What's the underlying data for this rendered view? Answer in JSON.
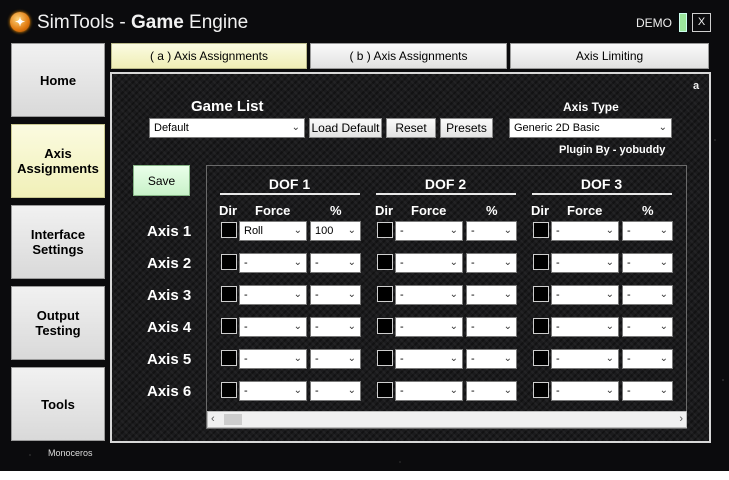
{
  "window": {
    "title_part1": "SimTools",
    "title_sep": " - ",
    "title_part2": "Game",
    "title_part3": " Engine",
    "demo_label": "DEMO",
    "close_label": "X"
  },
  "sidebar": {
    "items": [
      {
        "label": "Home"
      },
      {
        "label": "Axis Assignments"
      },
      {
        "label": "Interface Settings"
      },
      {
        "label": "Output Testing"
      },
      {
        "label": "Tools"
      }
    ],
    "brand": "Monoceros"
  },
  "tabs": [
    {
      "label": "( a ) Axis Assignments",
      "active": true
    },
    {
      "label": "( b ) Axis Assignments",
      "active": false
    },
    {
      "label": "Axis Limiting",
      "active": false
    }
  ],
  "panel": {
    "corner_label": "a",
    "game_list": {
      "label": "Game List",
      "value": "Default"
    },
    "load_default_label": "Load Default",
    "reset_label": "Reset",
    "presets_label": "Presets",
    "axis_type": {
      "label": "Axis Type",
      "value": "Generic 2D Basic"
    },
    "plugin_by": "Plugin By - yobuddy",
    "save_label": "Save",
    "dof_titles": [
      "DOF 1",
      "DOF 2",
      "DOF 3"
    ],
    "col_dir": "Dir",
    "col_force": "Force",
    "col_percent": "%",
    "axes": [
      {
        "label": "Axis 1",
        "dof": [
          {
            "force": "Roll",
            "pct": "100"
          },
          {
            "force": "-",
            "pct": "-"
          },
          {
            "force": "-",
            "pct": "-"
          }
        ]
      },
      {
        "label": "Axis 2",
        "dof": [
          {
            "force": "-",
            "pct": "-"
          },
          {
            "force": "-",
            "pct": "-"
          },
          {
            "force": "-",
            "pct": "-"
          }
        ]
      },
      {
        "label": "Axis 3",
        "dof": [
          {
            "force": "-",
            "pct": "-"
          },
          {
            "force": "-",
            "pct": "-"
          },
          {
            "force": "-",
            "pct": "-"
          }
        ]
      },
      {
        "label": "Axis 4",
        "dof": [
          {
            "force": "-",
            "pct": "-"
          },
          {
            "force": "-",
            "pct": "-"
          },
          {
            "force": "-",
            "pct": "-"
          }
        ]
      },
      {
        "label": "Axis 5",
        "dof": [
          {
            "force": "-",
            "pct": "-"
          },
          {
            "force": "-",
            "pct": "-"
          },
          {
            "force": "-",
            "pct": "-"
          }
        ]
      },
      {
        "label": "Axis 6",
        "dof": [
          {
            "force": "-",
            "pct": "-"
          },
          {
            "force": "-",
            "pct": "-"
          },
          {
            "force": "-",
            "pct": "-"
          }
        ]
      }
    ]
  },
  "colors": {
    "accent_active": "#f1f0b8",
    "save_green": "#c9f2c9",
    "demo_indicator": "#9be59b"
  }
}
